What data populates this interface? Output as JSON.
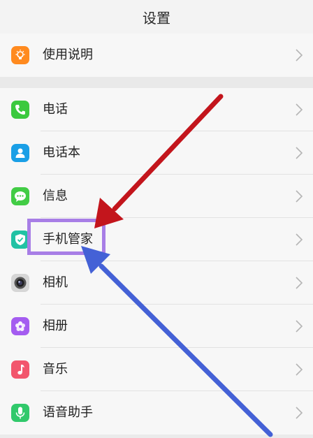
{
  "header": {
    "title": "设置"
  },
  "items": [
    {
      "label": "使用说明",
      "icon": "lightbulb-icon",
      "color": "#ff8a1f"
    },
    {
      "label": "电话",
      "icon": "phone-icon",
      "color": "#3bc93f"
    },
    {
      "label": "电话本",
      "icon": "contacts-icon",
      "color": "#1a9fe6"
    },
    {
      "label": "信息",
      "icon": "message-icon",
      "color": "#42cc45"
    },
    {
      "label": "手机管家",
      "icon": "shield-icon",
      "color": "#21c2a4"
    },
    {
      "label": "相机",
      "icon": "camera-icon",
      "color": "#555555"
    },
    {
      "label": "相册",
      "icon": "gallery-icon",
      "color": "#a45cf0"
    },
    {
      "label": "音乐",
      "icon": "music-icon",
      "color": "#f2566d"
    },
    {
      "label": "语音助手",
      "icon": "microphone-icon",
      "color": "#31c96b"
    }
  ],
  "annotations": {
    "highlight_color": "#a87ee6",
    "red_arrow_color": "#c3151c",
    "blue_arrow_color": "#4461d6"
  }
}
